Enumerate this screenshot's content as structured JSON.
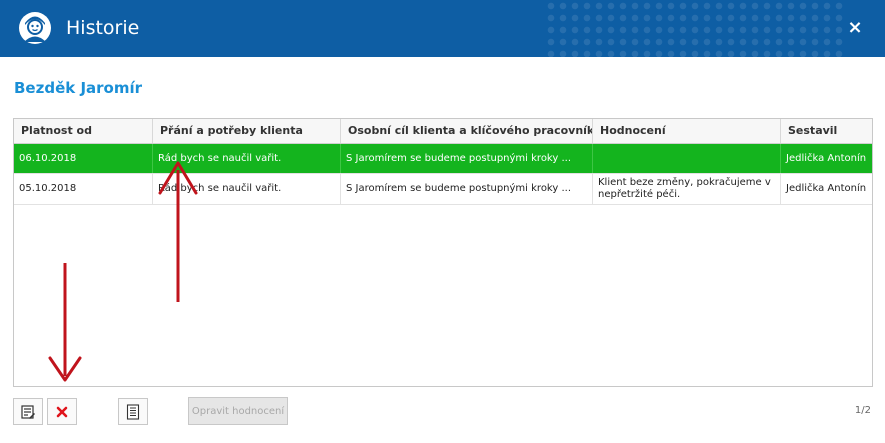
{
  "window": {
    "title": "Historie",
    "close_label": "×"
  },
  "client": {
    "name": "Bezděk Jaromír"
  },
  "table": {
    "columns": [
      "Platnost od",
      "Přání a potřeby klienta",
      "Osobní cíl klienta a klíčového pracovníka",
      "Hodnocení",
      "Sestavil"
    ],
    "rows": [
      {
        "platnost": "06.10.2018",
        "prani": "Rád bych se naučil vařit.",
        "cil": "S Jaromírem se budeme postupnými kroky ...",
        "hodnoceni": "",
        "sestavil": "Jedlička Antonín"
      },
      {
        "platnost": "05.10.2018",
        "prani": "Rád bych se naučil vařit.",
        "cil": "S Jaromírem se budeme postupnými kroky ...",
        "hodnoceni": "Klient beze změny, pokračujeme v nepřetržité péči.",
        "sestavil": "Jedlička Antonín"
      }
    ]
  },
  "toolbar": {
    "edit_icon": "edit-note-icon",
    "delete_icon": "red-x-icon",
    "document_icon": "document-icon",
    "opravit_label": "Opravit hodnocení",
    "pager": "1/2"
  },
  "colors": {
    "titlebar": "#0e5ea4",
    "client_name": "#1a8fd6",
    "selected_row": "#14b41e",
    "annotation_arrow": "#c0141c"
  }
}
